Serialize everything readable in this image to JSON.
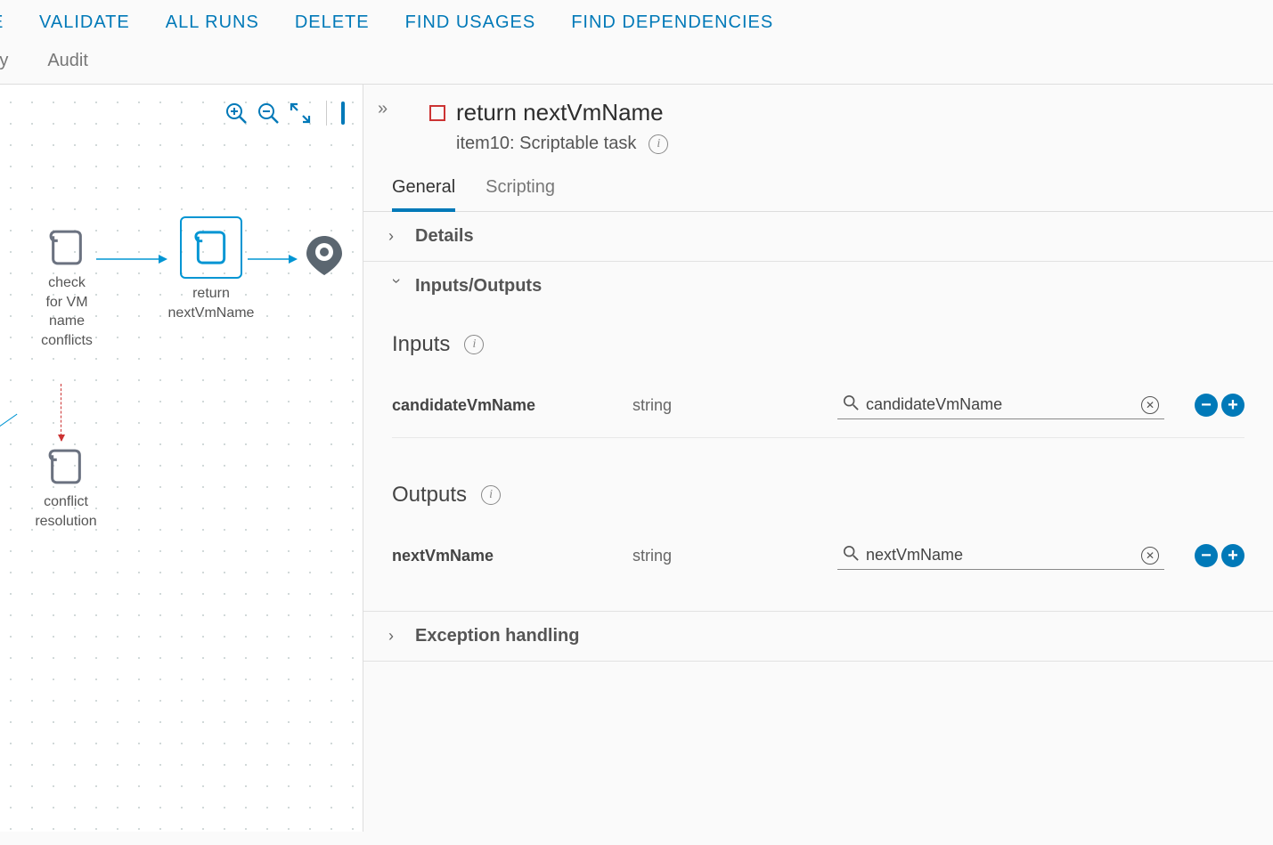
{
  "toolbar": {
    "partial_action": "E",
    "validate": "VALIDATE",
    "all_runs": "ALL RUNS",
    "delete": "DELETE",
    "find_usages": "FIND USAGES",
    "find_dependencies": "FIND DEPENDENCIES"
  },
  "subtabs": {
    "history_partial": "tory",
    "audit": "Audit"
  },
  "canvas": {
    "node_check": "check\nfor VM\nname\nconflicts",
    "node_return": "return\nnextVmName",
    "node_conflict": "conflict\nresolution"
  },
  "panel": {
    "title": "return nextVmName",
    "subtitle": "item10: Scriptable task",
    "tabs": {
      "general": "General",
      "scripting": "Scripting"
    },
    "sections": {
      "details": "Details",
      "io": "Inputs/Outputs",
      "exception": "Exception handling"
    },
    "inputs_label": "Inputs",
    "outputs_label": "Outputs",
    "inputs": [
      {
        "name": "candidateVmName",
        "type": "string",
        "value": "candidateVmName"
      }
    ],
    "outputs": [
      {
        "name": "nextVmName",
        "type": "string",
        "value": "nextVmName"
      }
    ]
  }
}
